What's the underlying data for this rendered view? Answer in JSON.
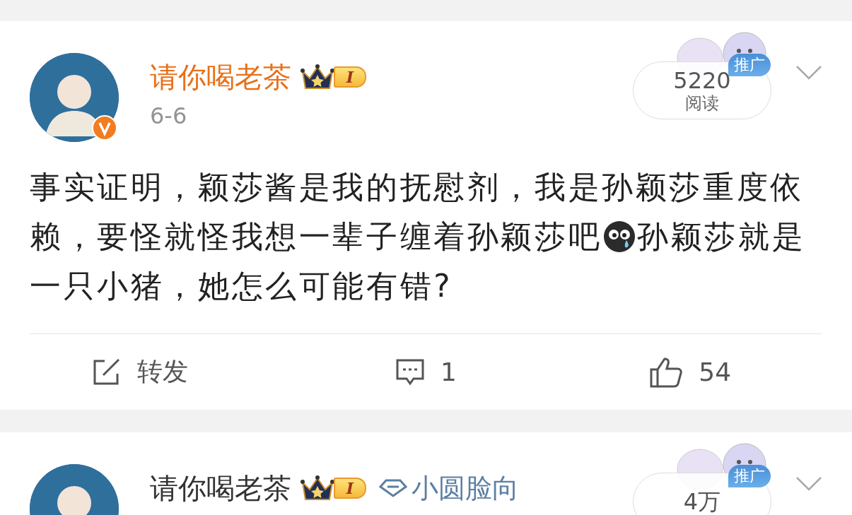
{
  "posts": [
    {
      "author": {
        "name": "请你喝老茶",
        "vip": true,
        "verified": true,
        "level_badge": "I"
      },
      "date": "6-6",
      "reads": {
        "count": "5220",
        "label": "阅读"
      },
      "promo": "推广",
      "lines": [
        [
          {
            "kind": "text",
            "text": "事实证明，颖莎酱是我的抚慰剂，我是孙颖莎重度依"
          }
        ],
        [
          {
            "kind": "text",
            "text": "赖，要怪就怪我想一辈子缠着孙颖莎吧"
          },
          {
            "kind": "emoji"
          },
          {
            "kind": "text",
            "text": "孙颖莎就是"
          }
        ],
        [
          {
            "kind": "text",
            "text": "一只小猪，她怎么可能有错?"
          }
        ]
      ],
      "actions": [
        {
          "kind": "repost",
          "label": "转发"
        },
        {
          "kind": "comment",
          "label": "1"
        },
        {
          "kind": "like",
          "label": "54"
        }
      ]
    },
    {
      "author": {
        "name": "请你喝老茶",
        "vip": false,
        "level_badge": "I",
        "tag": "小圆脸向"
      },
      "reads": {
        "count": "4万"
      },
      "promo": "推广"
    }
  ]
}
